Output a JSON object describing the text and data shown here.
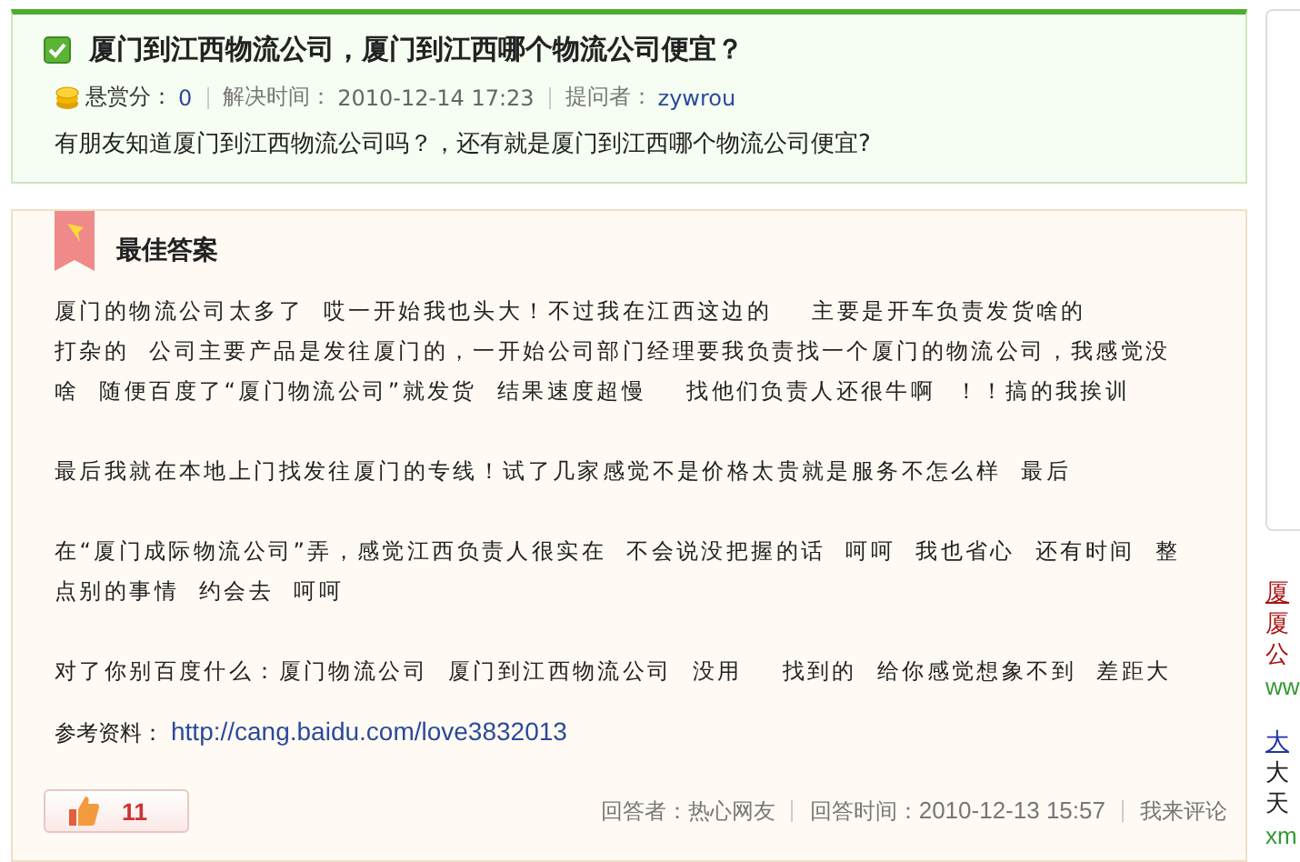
{
  "question": {
    "solved": true,
    "title": "厦门到江西物流公司，厦门到江西哪个物流公司便宜？",
    "meta": [
      {
        "label": "悬赏分：",
        "value": "0",
        "kind": "reward"
      },
      {
        "label": "解决时间：",
        "value": "2010-12-14 17:23",
        "kind": "plain"
      },
      {
        "label": "提问者：",
        "value": "zywrou",
        "kind": "user"
      }
    ],
    "body": "有朋友知道厦门到江西物流公司吗？，还有就是厦门到江西哪个物流公司便宜?"
  },
  "answer": {
    "heading": "最佳答案",
    "paragraphs": [
      [
        "厦门的物流公司太多了  哎一开始我也头大！不过我在江西这边的    主要是开车负责发货啥的",
        "打杂的  公司主要产品是发往厦门的，一开始公司部门经理要我负责找一个厦门的物流公司，我感觉没啥  随便百度了“厦门物流公司”就发货  结果速度超慢    找他们负责人还很牛啊  ！！搞的我挨训"
      ],
      [
        "最后我就在本地上门找发往厦门的专线！试了几家感觉不是价格太贵就是服务不怎么样  最后"
      ],
      [
        "在“厦门成际物流公司”弄，感觉江西负责人很实在  不会说没把握的话  呵呵  我也省心  还有时间  整点别的事情  约会去  呵呵"
      ],
      [
        "对了你别百度什么：厦门物流公司  厦门到江西物流公司  没用    找到的  给你感觉想象不到  差距大"
      ]
    ],
    "reference_label": "参考资料：",
    "reference_link": "http://cang.baidu.com/love3832013",
    "likes": "11",
    "meta": [
      {
        "label": "回答者：",
        "value": "热心网友"
      },
      {
        "label": "回答时间：",
        "value": "2010-12-13 15:57"
      }
    ],
    "comment_link": "我来评论"
  },
  "sidebar": {
    "ads": [
      {
        "title": "厦",
        "lines": [
          "厦",
          "公"
        ],
        "url": "ww"
      },
      {
        "title": "大",
        "lines": [
          "大",
          "天"
        ],
        "url": "xm"
      }
    ]
  }
}
